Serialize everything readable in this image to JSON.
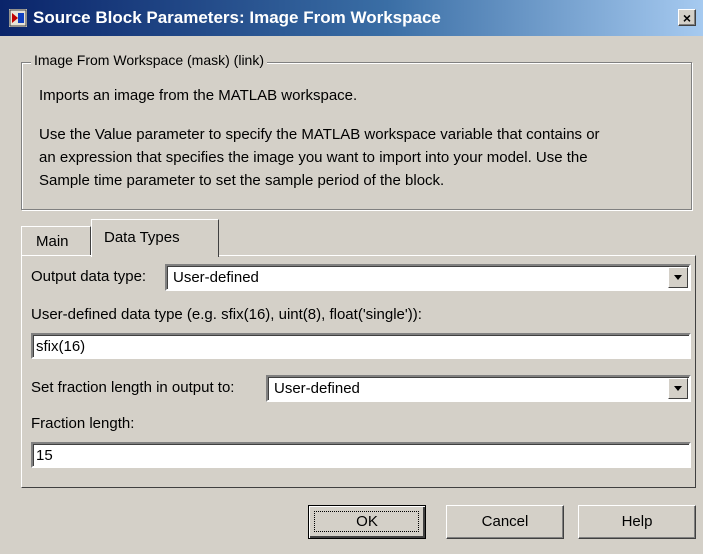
{
  "window": {
    "title": "Source Block Parameters: Image From Workspace",
    "close_glyph": "×"
  },
  "description": {
    "group_label": "Image From Workspace (mask) (link)",
    "line1": "Imports an image from the MATLAB workspace.",
    "line2": "Use the Value parameter to specify the MATLAB workspace variable that contains or",
    "line3": "an expression that specifies the image you want to import into your model. Use the",
    "line4": "Sample time parameter to set the sample period of the block."
  },
  "tabs": [
    {
      "label": "Main",
      "active": false
    },
    {
      "label": "Data Types",
      "active": true
    }
  ],
  "form": {
    "output_type_label": "Output data type:",
    "output_type_value": "User-defined",
    "user_type_label": "User-defined data type (e.g. sfix(16), uint(8), float('single')):",
    "user_type_value": "sfix(16)",
    "fraction_mode_label": "Set fraction length in output to:",
    "fraction_mode_value": "User-defined",
    "fraction_length_label": "Fraction length:",
    "fraction_length_value": "15"
  },
  "buttons": {
    "ok": "OK",
    "cancel": "Cancel",
    "help": "Help"
  },
  "colors": {
    "dialog_bg": "#d4d0c8",
    "titlebar_start": "#0a246a",
    "titlebar_end": "#a6caf0"
  },
  "icons": {
    "title": "simulink-block-icon",
    "close": "close-icon",
    "dropdown": "chevron-down-icon"
  }
}
